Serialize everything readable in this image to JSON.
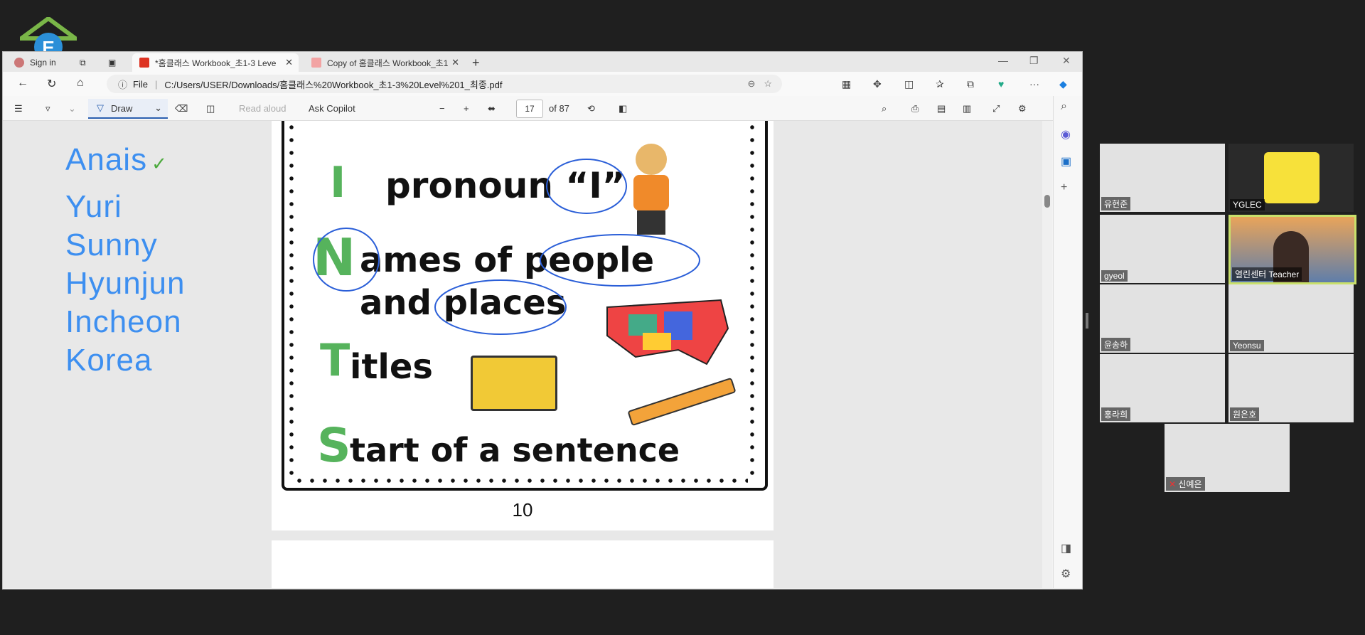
{
  "tabs": [
    {
      "label": "Sign in",
      "active": false
    },
    {
      "label": "*홈클래스 Workbook_초1-3 Leve",
      "active": true
    },
    {
      "label": "Copy of 홈클래스 Workbook_초1",
      "active": false
    }
  ],
  "address": {
    "prefix": "File",
    "url": "C:/Users/USER/Downloads/홈클래스%20Workbook_초1-3%20Level%201_최종.pdf"
  },
  "pdf_toolbar": {
    "draw": "Draw",
    "read_aloud": "Read aloud",
    "ask_copilot": "Ask Copilot",
    "page": "17",
    "of": "of 87"
  },
  "names": [
    "Anais",
    "Yuri",
    "Sunny",
    "Hyunjun",
    "Incheon",
    "Korea"
  ],
  "check_mark": "✓",
  "worksheet": {
    "row_i_letter": "I",
    "row_i_text": "pronoun “I”",
    "row_n_letter": "N",
    "row_n_text": "ames of people",
    "row_n_text2": "and places",
    "row_t_letter": "T",
    "row_t_text": "itles",
    "row_s_letter": "S",
    "row_s_text": "tart of a sentence",
    "page_number": "10"
  },
  "participants": [
    {
      "name": "유현준"
    },
    {
      "name": "YGLEC"
    },
    {
      "name": "gyeol"
    },
    {
      "name": "열린센터 Teacher"
    },
    {
      "name": "윤송하"
    },
    {
      "name": "Yeonsu"
    },
    {
      "name": "홍라희"
    },
    {
      "name": "원은호"
    },
    {
      "name": "신예은"
    }
  ],
  "colors": {
    "accent": "#3d8ff0",
    "green": "#56b35c",
    "speaker_border": "#c9e06b"
  }
}
